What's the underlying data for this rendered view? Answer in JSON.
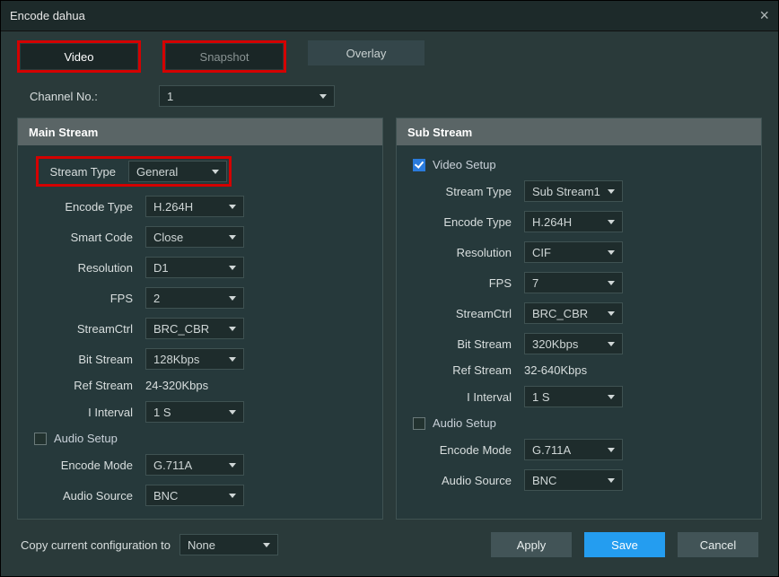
{
  "dialog": {
    "title": "Encode dahua"
  },
  "tabs": {
    "video": "Video",
    "snapshot": "Snapshot",
    "overlay": "Overlay"
  },
  "channel": {
    "label": "Channel No.:",
    "value": "1"
  },
  "main": {
    "header": "Main Stream",
    "streamType": {
      "label": "Stream Type",
      "value": "General"
    },
    "encodeType": {
      "label": "Encode Type",
      "value": "H.264H"
    },
    "smartCode": {
      "label": "Smart Code",
      "value": "Close"
    },
    "resolution": {
      "label": "Resolution",
      "value": "D1"
    },
    "fps": {
      "label": "FPS",
      "value": "2"
    },
    "streamCtrl": {
      "label": "StreamCtrl",
      "value": "BRC_CBR"
    },
    "bitStream": {
      "label": "Bit Stream",
      "value": "128Kbps"
    },
    "refStream": {
      "label": "Ref Stream",
      "value": "24-320Kbps"
    },
    "iInterval": {
      "label": "I Interval",
      "value": "1 S"
    },
    "audioSetup": {
      "label": "Audio Setup",
      "checked": false
    },
    "encodeMode": {
      "label": "Encode Mode",
      "value": "G.711A"
    },
    "audioSource": {
      "label": "Audio Source",
      "value": "BNC"
    }
  },
  "sub": {
    "header": "Sub Stream",
    "videoSetup": {
      "label": "Video Setup",
      "checked": true
    },
    "streamType": {
      "label": "Stream Type",
      "value": "Sub Stream1"
    },
    "encodeType": {
      "label": "Encode Type",
      "value": "H.264H"
    },
    "resolution": {
      "label": "Resolution",
      "value": "CIF"
    },
    "fps": {
      "label": "FPS",
      "value": "7"
    },
    "streamCtrl": {
      "label": "StreamCtrl",
      "value": "BRC_CBR"
    },
    "bitStream": {
      "label": "Bit Stream",
      "value": "320Kbps"
    },
    "refStream": {
      "label": "Ref Stream",
      "value": "32-640Kbps"
    },
    "iInterval": {
      "label": "I Interval",
      "value": "1 S"
    },
    "audioSetup": {
      "label": "Audio Setup",
      "checked": false
    },
    "encodeMode": {
      "label": "Encode Mode",
      "value": "G.711A"
    },
    "audioSource": {
      "label": "Audio Source",
      "value": "BNC"
    }
  },
  "footer": {
    "copyLabel": "Copy current configuration to",
    "copyValue": "None",
    "apply": "Apply",
    "save": "Save",
    "cancel": "Cancel"
  }
}
